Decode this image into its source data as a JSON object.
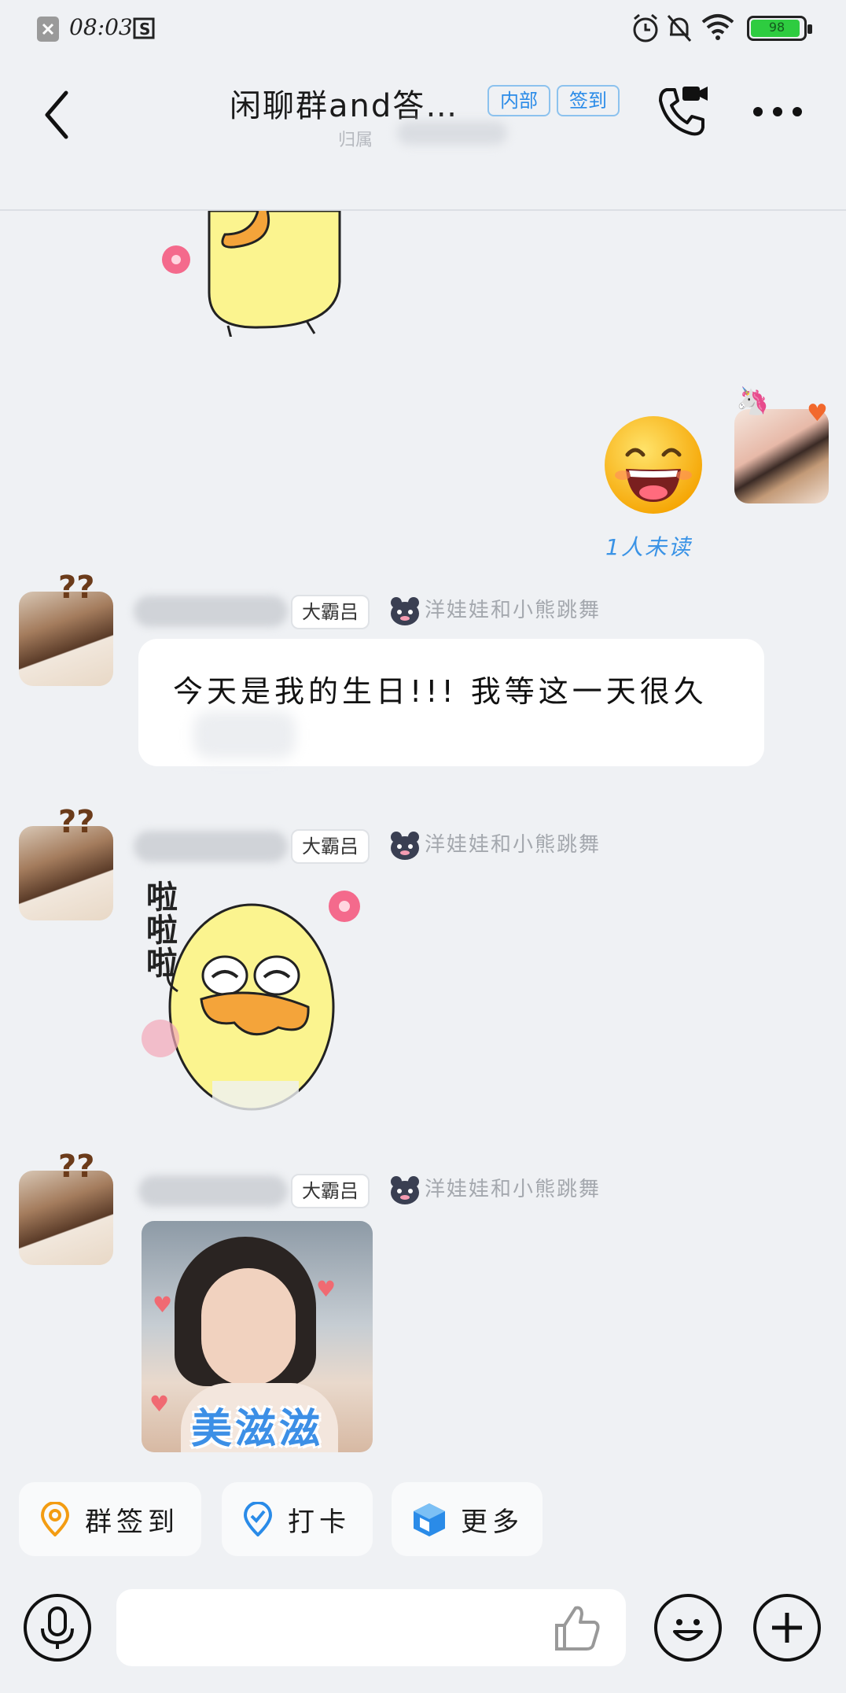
{
  "status_bar": {
    "time": "08:03",
    "battery": "98"
  },
  "header": {
    "title": "闲聊群and答…",
    "subtitle": "归属",
    "tags": [
      "内部",
      "签到"
    ]
  },
  "messages": [
    {
      "type": "sticker",
      "sender": "self",
      "status": "1人未读"
    },
    {
      "type": "text",
      "badge": "大霸吕",
      "title": "洋娃娃和小熊跳舞",
      "text": "今天是我的生日!!! 我等这一天很久"
    },
    {
      "type": "sticker",
      "badge": "大霸吕",
      "title": "洋娃娃和小熊跳舞",
      "sticker_text": [
        "啦",
        "啦",
        "啦"
      ]
    },
    {
      "type": "image",
      "badge": "大霸吕",
      "title": "洋娃娃和小熊跳舞",
      "caption": "美滋滋"
    }
  ],
  "quick_actions": [
    {
      "label": "群签到",
      "icon": "location-pin-icon",
      "color": "#f39c12"
    },
    {
      "label": "打卡",
      "icon": "check-badge-icon",
      "color": "#2a8be8"
    },
    {
      "label": "更多",
      "icon": "cube-icon",
      "color": "#2a8be8"
    }
  ],
  "colors": {
    "accent": "#2a8be8",
    "background": "#eff1f4",
    "unread": "#3a93e6"
  }
}
